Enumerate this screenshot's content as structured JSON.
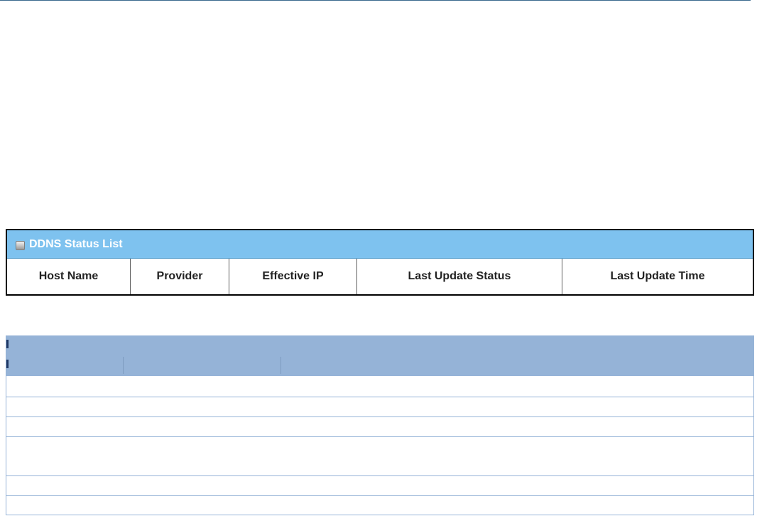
{
  "status_list": {
    "title": "DDNS Status List",
    "icon": "panel-bullet-icon",
    "columns": [
      "Host Name",
      "Provider",
      "Effective IP",
      "Last Update Status",
      "Last Update Time"
    ]
  },
  "colors": {
    "status_header": "#7ec2ef",
    "table_header": "#95b3d7",
    "row_border": "#95b3d7",
    "top_rule": "#3c6a8f"
  }
}
